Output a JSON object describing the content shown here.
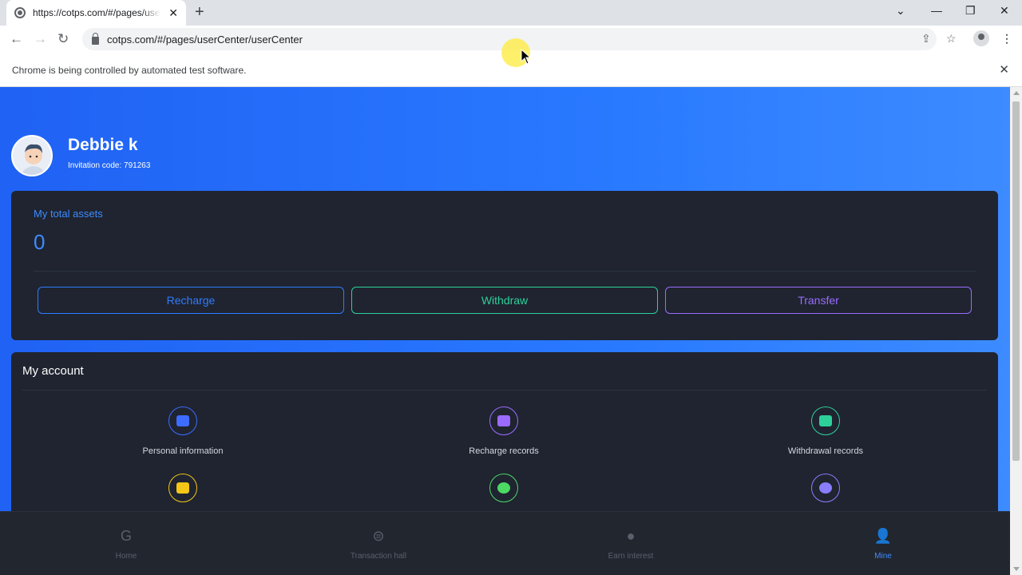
{
  "browser": {
    "tab_title": "https://cotps.com/#/pages/userCenter/userCenter",
    "url": "cotps.com/#/pages/userCenter/userCenter",
    "infobar_message": "Chrome is being controlled by automated test software."
  },
  "user": {
    "name": "Debbie k",
    "invitation": "Invitation code: 791263"
  },
  "assets": {
    "label": "My total assets",
    "amount": "0",
    "actions": [
      {
        "label": "Recharge",
        "color": "#2f7bff"
      },
      {
        "label": "Withdraw",
        "color": "#2ed09a"
      },
      {
        "label": "Transfer",
        "color": "#9b6bff"
      }
    ]
  },
  "account": {
    "title": "My account",
    "items": [
      {
        "label": "Personal information",
        "icon": "id-card-icon",
        "color": "#3d6cff"
      },
      {
        "label": "Recharge records",
        "icon": "wallet-icon",
        "color": "#9b6bff"
      },
      {
        "label": "Withdrawal records",
        "icon": "calendar-icon",
        "color": "#2ed09a"
      },
      {
        "label": "",
        "icon": "bill-icon",
        "color": "#f5c518"
      },
      {
        "label": "",
        "icon": "user-check-icon",
        "color": "#4cd964"
      },
      {
        "label": "",
        "icon": "team-icon",
        "color": "#8a7dff"
      }
    ]
  },
  "bottom_nav": [
    {
      "label": "Home",
      "icon": "home-icon"
    },
    {
      "label": "Transaction hall",
      "icon": "exchange-icon"
    },
    {
      "label": "Earn interest",
      "icon": "earn-icon"
    },
    {
      "label": "Mine",
      "icon": "user-icon",
      "active": true
    }
  ]
}
